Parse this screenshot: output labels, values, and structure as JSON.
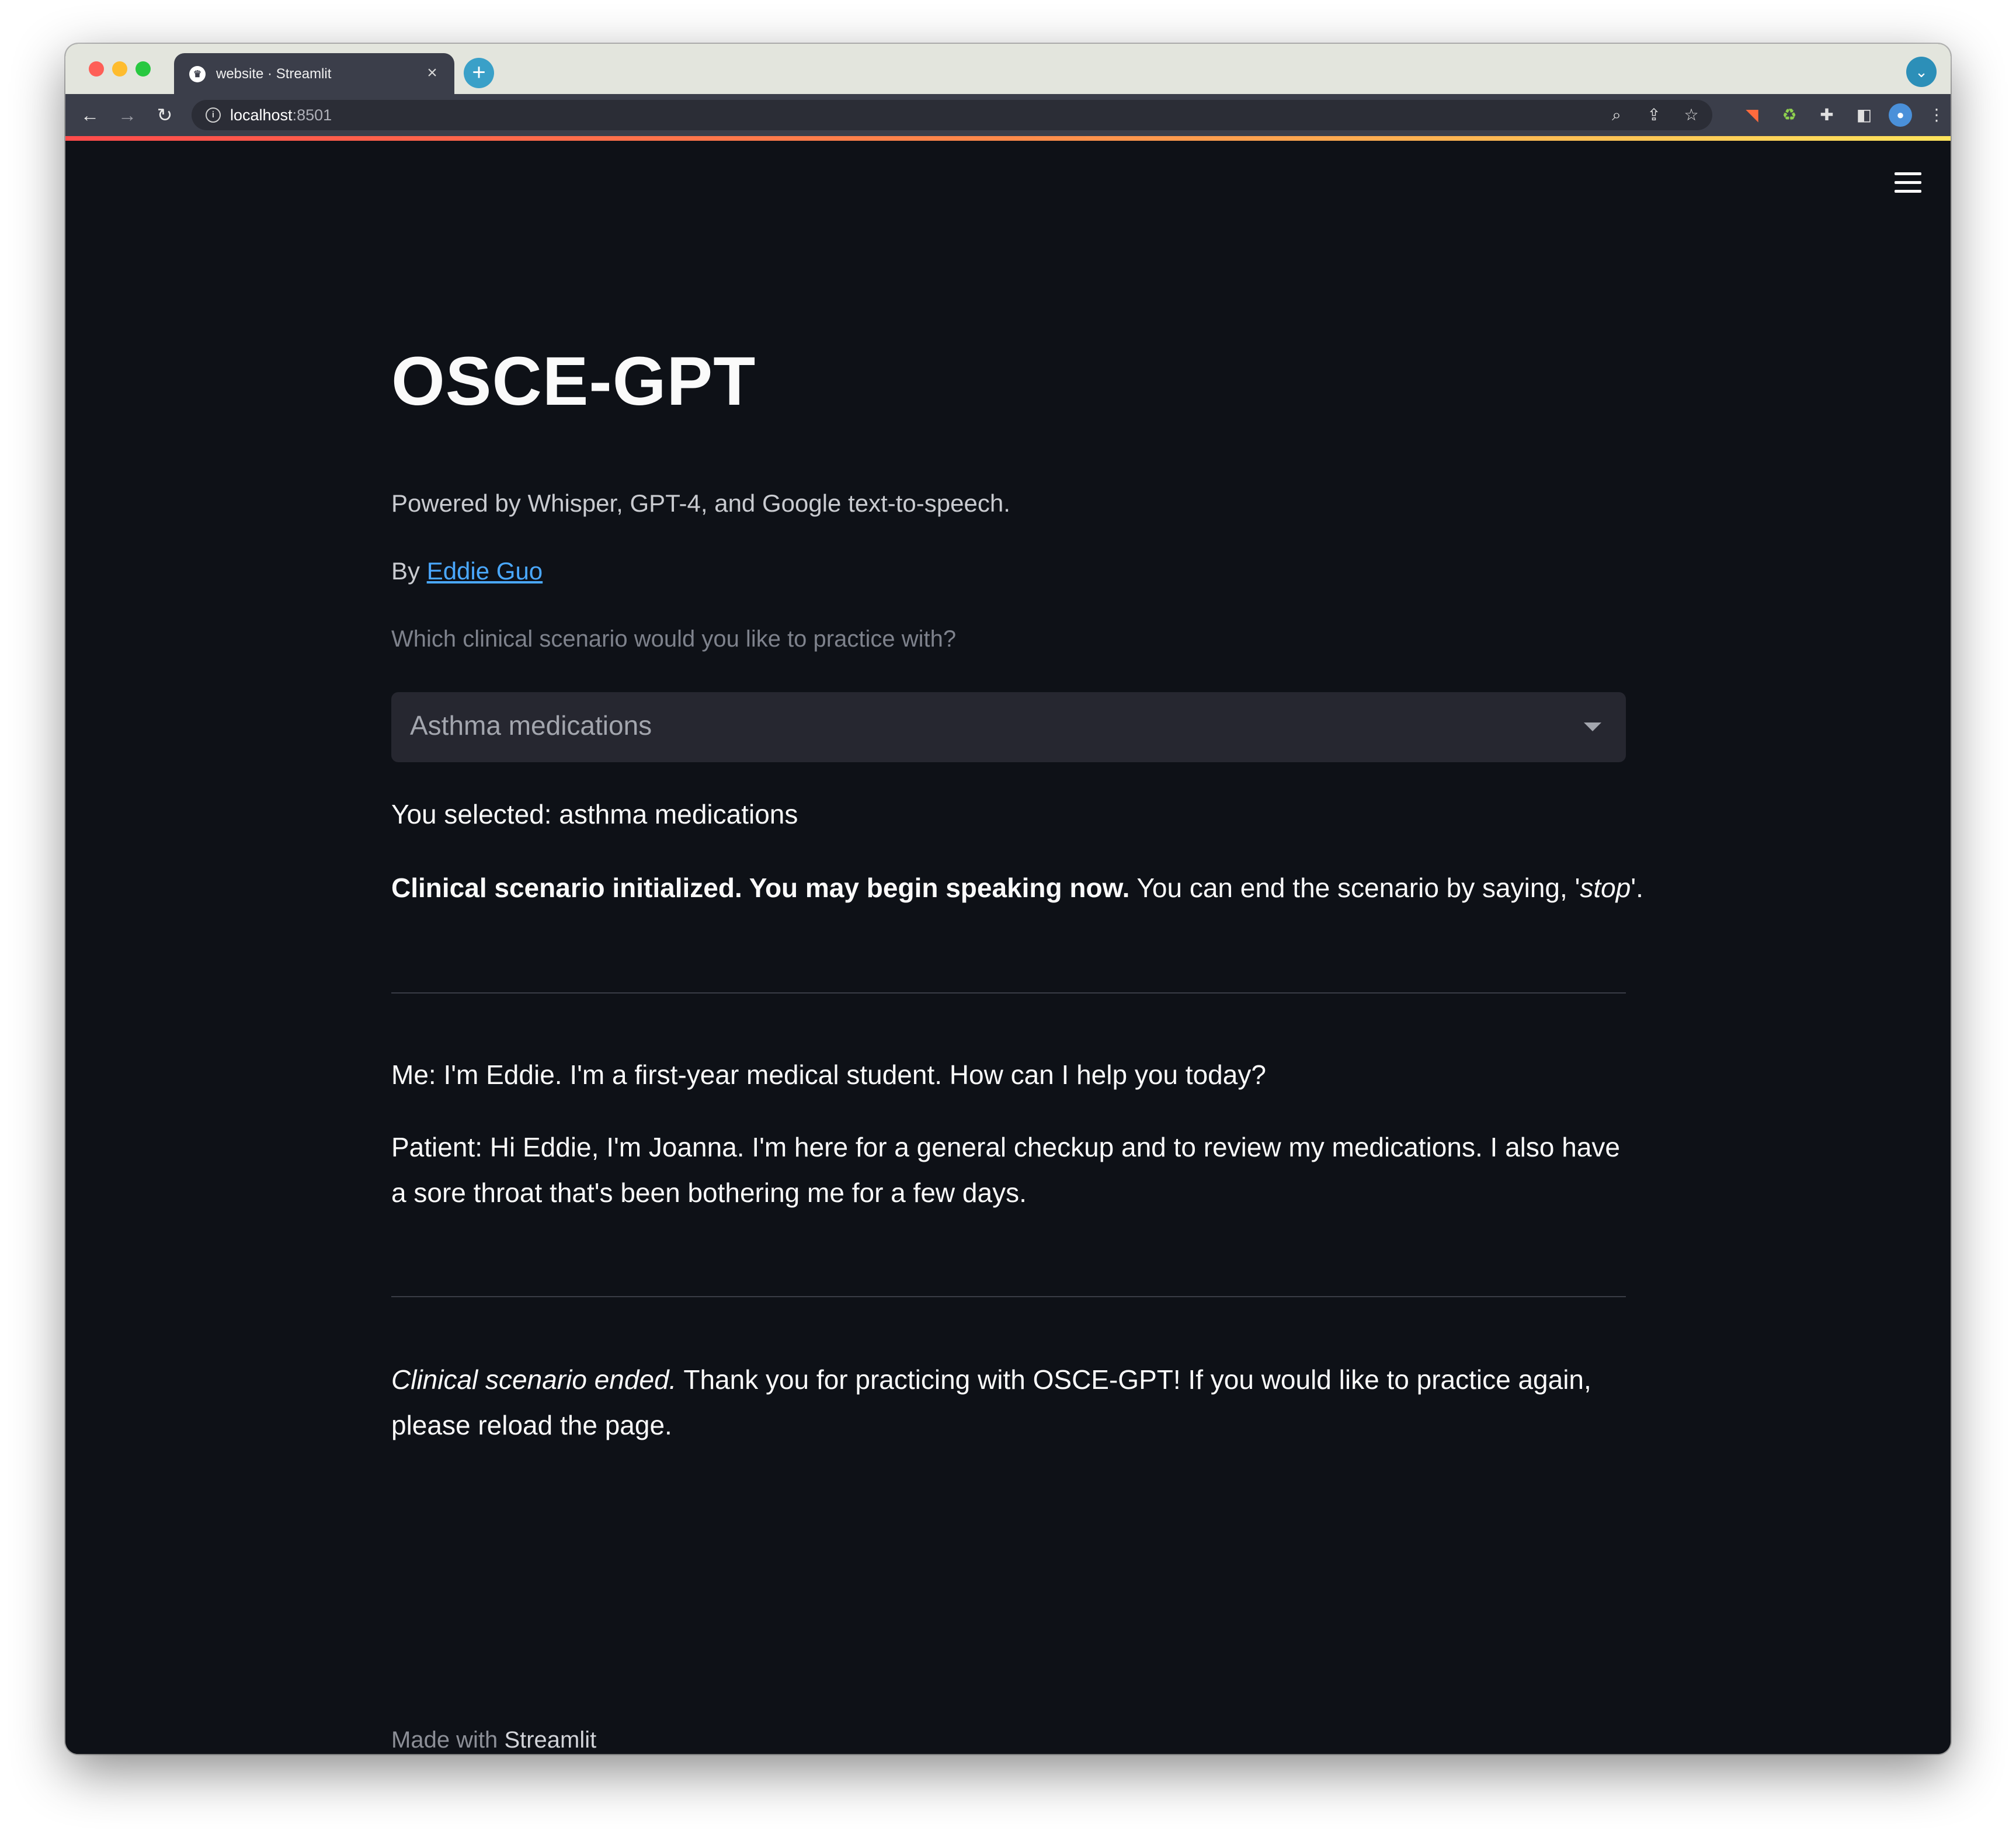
{
  "browser": {
    "tab_title": "website · Streamlit",
    "tab_close": "×",
    "new_tab": "+",
    "url_host": "localhost",
    "url_port": ":8501"
  },
  "app": {
    "title": "OSCE-GPT",
    "subtitle": "Powered by Whisper, GPT-4, and Google text-to-speech.",
    "byline_prefix": "By",
    "author": "Eddie Guo",
    "select_label": "Which clinical scenario would you like to practice with?",
    "select_value": "Asthma medications",
    "selected_text": "You selected: asthma medications",
    "init_bold": "Clinical scenario initialized. You may begin speaking now.",
    "init_rest": " You can end the scenario by saying, '",
    "init_stop": "stop",
    "init_end": "'.",
    "conversation": [
      "Me: I'm Eddie. I'm a first-year medical student. How can I help you today?",
      "Patient: Hi Eddie, I'm Joanna. I'm here for a general checkup and to review my medications. I also have a sore throat that's been bothering me for a few days."
    ],
    "ended_italic": "Clinical scenario ended.",
    "ended_rest": " Thank you for practicing with OSCE-GPT! If you would like to practice again, please reload the page.",
    "footer_prefix": "Made with",
    "footer_brand": "Streamlit"
  },
  "colors": {
    "app_background": "#0e1117",
    "select_background": "#262730",
    "link": "#4aa8ff",
    "top_gradient": [
      "#ff4b4b",
      "#ffe45c"
    ]
  },
  "icons": [
    "close-icon",
    "new-tab-icon",
    "back-icon",
    "forward-icon",
    "reload-icon",
    "info-icon",
    "zoom-icon",
    "share-icon",
    "star-icon",
    "extensions-icon",
    "sidebar-icon",
    "profile-icon",
    "more-icon",
    "hamburger-menu-icon",
    "chevron-down-icon"
  ]
}
